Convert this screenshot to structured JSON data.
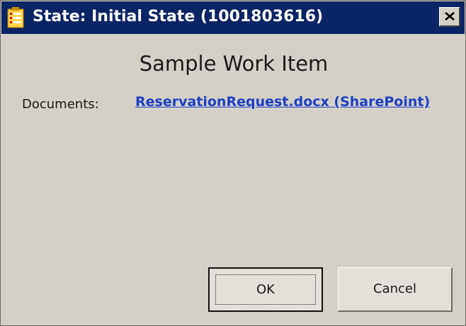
{
  "window": {
    "title": "State: Initial State (1001803616)",
    "title_icon": "document-list-icon",
    "close_icon": "close-icon"
  },
  "content": {
    "heading": "Sample Work Item",
    "documents_label": "Documents:",
    "document_link": "ReservationRequest.docx (SharePoint)"
  },
  "buttons": {
    "ok_label": "OK",
    "cancel_label": "Cancel"
  },
  "colors": {
    "titlebar": "#0b2466",
    "dialog_background": "#d4d0c8",
    "link": "#1f3fc4"
  }
}
